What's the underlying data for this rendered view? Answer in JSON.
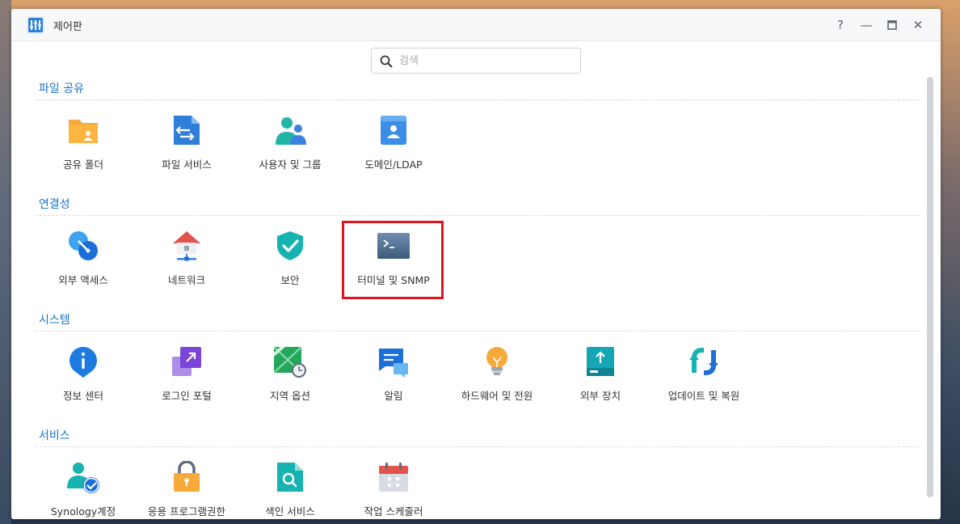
{
  "window": {
    "title": "제어판",
    "help_glyph": "?",
    "minimize_glyph": "—",
    "close_glyph": "✕"
  },
  "search": {
    "placeholder": "검색"
  },
  "sections": [
    {
      "title": "파일 공유",
      "items": [
        {
          "label": "공유 폴더",
          "icon": "shared-folder-icon"
        },
        {
          "label": "파일 서비스",
          "icon": "file-services-icon"
        },
        {
          "label": "사용자 및 그룹",
          "icon": "user-group-icon"
        },
        {
          "label": "도메인/LDAP",
          "icon": "domain-ldap-icon"
        }
      ]
    },
    {
      "title": "연결성",
      "items": [
        {
          "label": "외부 액세스",
          "icon": "external-access-icon"
        },
        {
          "label": "네트워크",
          "icon": "network-icon"
        },
        {
          "label": "보안",
          "icon": "security-shield-icon"
        },
        {
          "label": "터미널 및 SNMP",
          "icon": "terminal-icon"
        }
      ]
    },
    {
      "title": "시스템",
      "items": [
        {
          "label": "정보 센터",
          "icon": "info-center-icon"
        },
        {
          "label": "로그인 포털",
          "icon": "login-portal-icon"
        },
        {
          "label": "지역 옵션",
          "icon": "regional-options-icon"
        },
        {
          "label": "알림",
          "icon": "notification-icon"
        },
        {
          "label": "하드웨어 및 전원",
          "icon": "hardware-power-icon"
        },
        {
          "label": "외부 장치",
          "icon": "external-devices-icon"
        },
        {
          "label": "업데이트 및 복원",
          "icon": "update-restore-icon"
        }
      ]
    },
    {
      "title": "서비스",
      "items": [
        {
          "label": "Synology계정",
          "icon": "synology-account-icon"
        },
        {
          "label": "응용 프로그램권한",
          "icon": "app-privileges-icon"
        },
        {
          "label": "색인 서비스",
          "icon": "indexing-service-icon"
        },
        {
          "label": "작업 스케줄러",
          "icon": "task-scheduler-icon"
        }
      ]
    }
  ],
  "colors": {
    "section_title": "#1a73c9",
    "highlight_border": "#e0141e",
    "window_bg": "#ffffff"
  }
}
